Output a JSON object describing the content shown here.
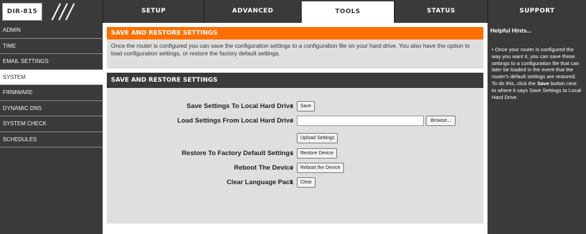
{
  "header": {
    "model": "DIR-815",
    "tabs": [
      {
        "label": "SETUP",
        "active": false
      },
      {
        "label": "ADVANCED",
        "active": false
      },
      {
        "label": "TOOLS",
        "active": true
      },
      {
        "label": "STATUS",
        "active": false
      },
      {
        "label": "SUPPORT",
        "active": false
      }
    ]
  },
  "sidebar": {
    "items": [
      {
        "label": "ADMIN",
        "active": false
      },
      {
        "label": "TIME",
        "active": false
      },
      {
        "label": "EMAIL SETTINGS",
        "active": false
      },
      {
        "label": "SYSTEM",
        "active": true
      },
      {
        "label": "FIRMWARE",
        "active": false
      },
      {
        "label": "DYNAMIC DNS",
        "active": false
      },
      {
        "label": "SYSTEM CHECK",
        "active": false
      },
      {
        "label": "SCHEDULES",
        "active": false
      }
    ]
  },
  "main": {
    "title": "SAVE AND RESTORE SETTINGS",
    "intro": "Once the router is configured you can save the configuration settings to a configuration file on your hard drive. You also have the option to load configuration settings, or restore the factory default settings.",
    "settings_title": "SAVE AND RESTORE SETTINGS",
    "rows": {
      "save": {
        "label": "Save Settings To Local Hard Drive",
        "button": "Save"
      },
      "load": {
        "label": "Load Settings From Local Hard Drive",
        "browse": "Browse...",
        "button": "Upload Settings"
      },
      "restore": {
        "label": "Restore To Factory Default Settings",
        "button": "Restore Device"
      },
      "reboot": {
        "label": "Reboot The Device",
        "button": "Reboot the Device"
      },
      "clear": {
        "label": "Clear Language Pack",
        "button": "Clear"
      }
    },
    "colon": ":"
  },
  "hints": {
    "title": "Helpful Hints...",
    "bullet": "•",
    "text_before": "Once your router is configured the way you want it, you can save these settings to a configuration file that can later be loaded in the event that the router's default settings are restored. To do this, click the",
    "bold_word": "Save",
    "text_after": "button next to where it says Save Settings to Local Hard Drive."
  },
  "colors": {
    "orange": "#ff6f00",
    "dark": "#3a3a3a",
    "panel": "#dfdfdf"
  }
}
